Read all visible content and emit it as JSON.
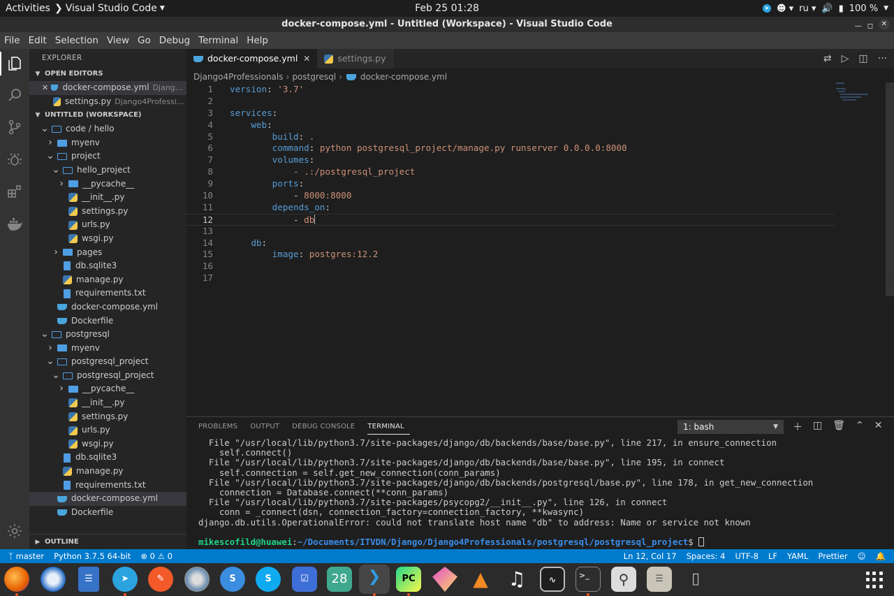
{
  "topbar": {
    "activities": "Activities",
    "app_name": "Visual Studio Code",
    "clock": "Feb 25  01:28",
    "lang": "ru",
    "battery": "100 %"
  },
  "window": {
    "title": "docker-compose.yml - Untitled (Workspace) - Visual Studio Code"
  },
  "menu": [
    "File",
    "Edit",
    "Selection",
    "View",
    "Go",
    "Debug",
    "Terminal",
    "Help"
  ],
  "sidebar": {
    "title": "EXPLORER",
    "open_editors_label": "OPEN EDITORS",
    "open_editors": [
      {
        "name": "docker-compose.yml",
        "desc": "Django4Pr...",
        "icon": "docker-icon"
      },
      {
        "name": "settings.py",
        "desc": "Django4Professional...",
        "icon": "python-icon"
      }
    ],
    "workspace_label": "UNTITLED (WORKSPACE)",
    "tree": [
      {
        "name": "code / hello",
        "indent": 0,
        "kind": "folder",
        "open": true
      },
      {
        "name": "myenv",
        "indent": 1,
        "kind": "folder",
        "open": false
      },
      {
        "name": "project",
        "indent": 1,
        "kind": "folder",
        "open": true
      },
      {
        "name": "hello_project",
        "indent": 2,
        "kind": "folder",
        "open": true
      },
      {
        "name": "__pycache__",
        "indent": 3,
        "kind": "folder",
        "open": false
      },
      {
        "name": "__init__.py",
        "indent": 3,
        "kind": "py"
      },
      {
        "name": "settings.py",
        "indent": 3,
        "kind": "py"
      },
      {
        "name": "urls.py",
        "indent": 3,
        "kind": "py"
      },
      {
        "name": "wsgi.py",
        "indent": 3,
        "kind": "py"
      },
      {
        "name": "pages",
        "indent": 2,
        "kind": "folder",
        "open": false
      },
      {
        "name": "db.sqlite3",
        "indent": 2,
        "kind": "file"
      },
      {
        "name": "manage.py",
        "indent": 2,
        "kind": "py"
      },
      {
        "name": "requirements.txt",
        "indent": 2,
        "kind": "file"
      },
      {
        "name": "docker-compose.yml",
        "indent": 1,
        "kind": "docker"
      },
      {
        "name": "Dockerfile",
        "indent": 1,
        "kind": "docker"
      },
      {
        "name": "postgresql",
        "indent": 0,
        "kind": "folder",
        "open": true
      },
      {
        "name": "myenv",
        "indent": 1,
        "kind": "folder",
        "open": false
      },
      {
        "name": "postgresql_project",
        "indent": 1,
        "kind": "folder",
        "open": true
      },
      {
        "name": "postgresql_project",
        "indent": 2,
        "kind": "folder",
        "open": true
      },
      {
        "name": "__pycache__",
        "indent": 3,
        "kind": "folder",
        "open": false
      },
      {
        "name": "__init__.py",
        "indent": 3,
        "kind": "py"
      },
      {
        "name": "settings.py",
        "indent": 3,
        "kind": "py"
      },
      {
        "name": "urls.py",
        "indent": 3,
        "kind": "py"
      },
      {
        "name": "wsgi.py",
        "indent": 3,
        "kind": "py"
      },
      {
        "name": "db.sqlite3",
        "indent": 2,
        "kind": "file"
      },
      {
        "name": "manage.py",
        "indent": 2,
        "kind": "py"
      },
      {
        "name": "requirements.txt",
        "indent": 2,
        "kind": "file"
      },
      {
        "name": "docker-compose.yml",
        "indent": 1,
        "kind": "docker",
        "selected": true
      },
      {
        "name": "Dockerfile",
        "indent": 1,
        "kind": "docker"
      }
    ],
    "outline_label": "OUTLINE"
  },
  "editor": {
    "tabs": [
      {
        "label": "docker-compose.yml",
        "icon": "docker-icon",
        "active": true
      },
      {
        "label": "settings.py",
        "icon": "python-icon",
        "active": false
      }
    ],
    "breadcrumb": [
      "Django4Professionals",
      "postgresql",
      "docker-compose.yml"
    ],
    "lines": [
      "1",
      "2",
      "3",
      "4",
      "5",
      "6",
      "7",
      "8",
      "9",
      "10",
      "11",
      "12",
      "13",
      "14",
      "15",
      "16",
      "17"
    ],
    "code": {
      "l1_key": "version",
      "l1_val": "'3.7'",
      "l3_key": "services",
      "l4_key": "web",
      "l5_key": "build",
      "l5_val": ".",
      "l6_key": "command",
      "l6_val": "python postgresql_project/manage.py runserver 0.0.0.0:8000",
      "l7_key": "volumes",
      "l8_val": "- .:/postgresql_project",
      "l9_key": "ports",
      "l10_dash": "- ",
      "l10_val": "8000:8000",
      "l11_key": "depends_on",
      "l12_dash": "- ",
      "l12_val": "db",
      "l14_key": "db",
      "l15_key": "image",
      "l15_val": "postgres:12.2"
    },
    "current_line": 12
  },
  "panel": {
    "tabs": [
      "PROBLEMS",
      "OUTPUT",
      "DEBUG CONSOLE",
      "TERMINAL"
    ],
    "active_tab": "TERMINAL",
    "shell": "1: bash",
    "terminal_lines": [
      "  File \"/usr/local/lib/python3.7/site-packages/django/db/backends/base/base.py\", line 217, in ensure_connection",
      "    self.connect()",
      "  File \"/usr/local/lib/python3.7/site-packages/django/db/backends/base/base.py\", line 195, in connect",
      "    self.connection = self.get_new_connection(conn_params)",
      "  File \"/usr/local/lib/python3.7/site-packages/django/db/backends/postgresql/base.py\", line 178, in get_new_connection",
      "    connection = Database.connect(**conn_params)",
      "  File \"/usr/local/lib/python3.7/site-packages/psycopg2/__init__.py\", line 126, in connect",
      "    conn = _connect(dsn, connection_factory=connection_factory, **kwasync)",
      "django.db.utils.OperationalError: could not translate host name \"db\" to address: Name or service not known"
    ],
    "prompt_user": "mikescofild@huawei",
    "prompt_sep": ":",
    "prompt_path": "~/Documents/ITVDN/Django/Django4Professionals/postgresql/postgresql_project",
    "prompt_end": "$ "
  },
  "statusbar": {
    "branch": "master",
    "python": "Python 3.7.5 64-bit",
    "problems": "0 ⚠ 0",
    "position": "Ln 12, Col 17",
    "spaces": "Spaces: 4",
    "encoding": "UTF-8",
    "eol": "LF",
    "language": "YAML",
    "formatter": "Prettier"
  },
  "dock": {
    "calendar_day": "28",
    "apps": [
      "firefox",
      "thunderbird",
      "notes",
      "telegram",
      "pen",
      "gear-app",
      "simplenote",
      "skype",
      "todo",
      "calendar",
      "vscode",
      "pycharm",
      "crystal",
      "vlc",
      "music",
      "sysmonitor",
      "terminal",
      "search-app",
      "files",
      "usb"
    ]
  },
  "colors": {
    "accent": "#007acc",
    "sidebar": "#252526",
    "editor": "#1e1e1e"
  }
}
